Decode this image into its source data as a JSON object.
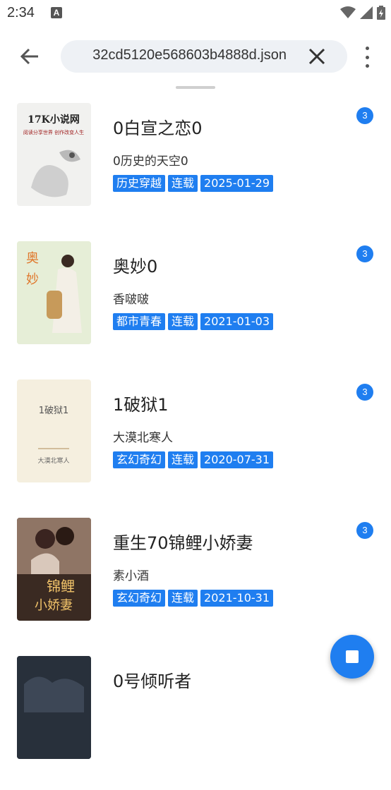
{
  "status": {
    "time": "2:34",
    "notification_icon": "A"
  },
  "toolbar": {
    "url": "32cd5120e568603b4888d.json"
  },
  "books": [
    {
      "title": "0白宣之恋0",
      "author": "0历史的天空0",
      "tags": [
        "历史穿越",
        "连载",
        "2025-01-29"
      ],
      "badge": "3",
      "cover": {
        "line1": "17K小说网",
        "line2": "阅读分享世界 创作改变人生",
        "bg": "#f1f1ef"
      }
    },
    {
      "title": "奥妙0",
      "author": "香啵啵",
      "tags": [
        "都市青春",
        "连载",
        "2021-01-03"
      ],
      "badge": "3",
      "cover": {
        "line1": "奥",
        "line2": "妙",
        "bg": "#dfe9cf"
      }
    },
    {
      "title": "1破狱1",
      "author": "大漠北寒人",
      "tags": [
        "玄幻奇幻",
        "连载",
        "2020-07-31"
      ],
      "badge": "3",
      "cover": {
        "line1": "1破狱1",
        "line2": "大漠北寒人",
        "bg": "#f5efdf"
      }
    },
    {
      "title": "重生70锦鲤小娇妻",
      "author": "素小酒",
      "tags": [
        "玄幻奇幻",
        "连载",
        "2021-10-31"
      ],
      "badge": "3",
      "cover": {
        "line1": "锦鲤",
        "line2": "小娇妻",
        "bg": "#3a2a22"
      }
    },
    {
      "title": "0号倾听者",
      "author": "",
      "tags": [],
      "badge": "",
      "cover": {
        "line1": "",
        "line2": "",
        "bg": "#2c3440"
      }
    }
  ],
  "colors": {
    "accent": "#1f7ef0"
  }
}
